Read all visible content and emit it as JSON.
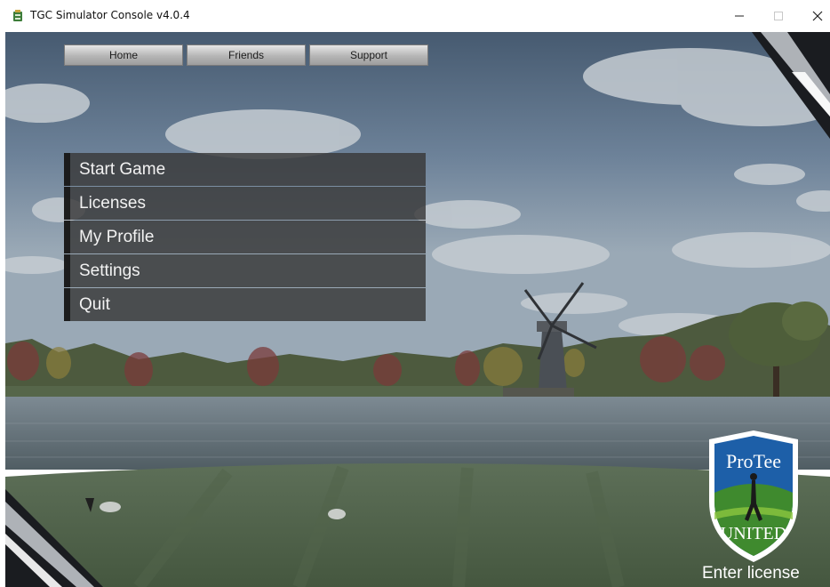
{
  "window": {
    "title": "TGC Simulator Console v4.0.4",
    "controls": [
      "minimize",
      "maximize",
      "close"
    ]
  },
  "topnav": {
    "items": [
      {
        "label": "Home"
      },
      {
        "label": "Friends"
      },
      {
        "label": "Support"
      }
    ]
  },
  "main_menu": {
    "items": [
      {
        "label": "Start Game"
      },
      {
        "label": "Licenses"
      },
      {
        "label": "My Profile"
      },
      {
        "label": "Settings"
      },
      {
        "label": "Quit"
      }
    ]
  },
  "branding": {
    "logo_text_top": "ProTee",
    "logo_text_bottom": "UNITED",
    "colors": {
      "shield_blue": "#1d5fa8",
      "shield_green": "#3f8a2e"
    }
  },
  "license": {
    "link_label": "Enter license"
  },
  "icons": [
    "app-icon",
    "minimize-icon",
    "maximize-icon",
    "close-icon"
  ]
}
